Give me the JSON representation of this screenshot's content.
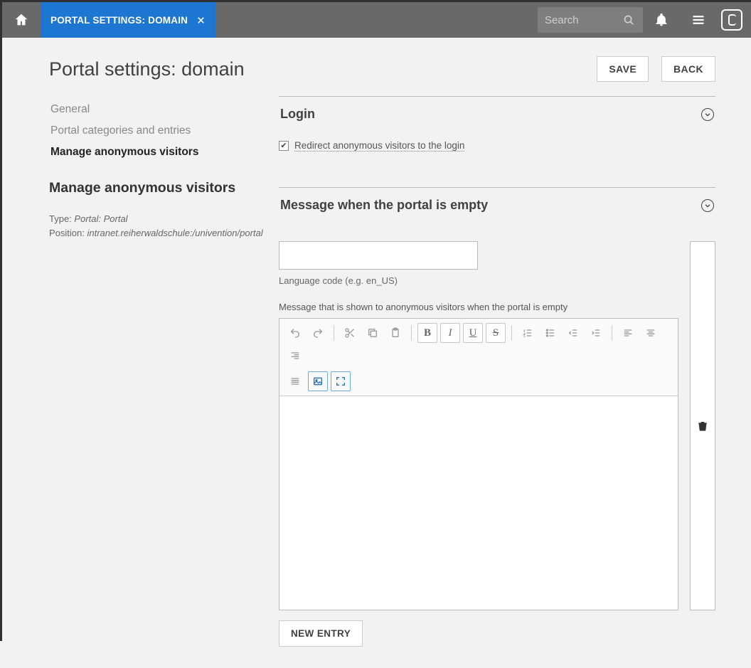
{
  "topbar": {
    "tab_label": "PORTAL SETTINGS: DOMAIN",
    "search_placeholder": "Search"
  },
  "buttons": {
    "save": "SAVE",
    "back": "BACK",
    "new_entry": "NEW ENTRY"
  },
  "page_title": "Portal settings: domain",
  "sidebar": {
    "nav": [
      {
        "label": "General"
      },
      {
        "label": "Portal categories and entries"
      },
      {
        "label": "Manage anonymous visitors"
      }
    ],
    "heading": "Manage anonymous visitors",
    "meta": {
      "type_label": "Type: ",
      "type_value": "Portal: Portal",
      "position_label": "Position: ",
      "position_value": "intranet.reiherwaldschule:/univention/portal"
    }
  },
  "sections": {
    "login": {
      "title": "Login",
      "checkbox_label": "Redirect anonymous visitors to the login",
      "checked": true
    },
    "empty_msg": {
      "title": "Message when the portal is empty",
      "lang_help": "Language code (e.g. en_US)",
      "msg_label": "Message that is shown to anonymous visitors when the portal is empty"
    }
  }
}
